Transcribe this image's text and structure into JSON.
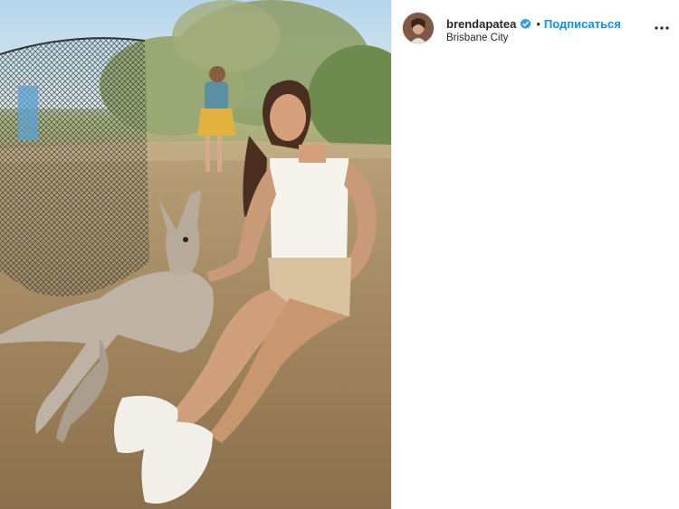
{
  "photo": {
    "subject": "photo"
  },
  "header": {
    "username": "brendapatea",
    "separator": "•",
    "follow_label": "Подписаться",
    "location": "Brisbane City"
  },
  "colors": {
    "accent": "#0095f6",
    "text": "#262626",
    "verified": "#3897f0"
  },
  "icons": {
    "verified": "verified-badge-icon",
    "more": "more-options-icon"
  }
}
